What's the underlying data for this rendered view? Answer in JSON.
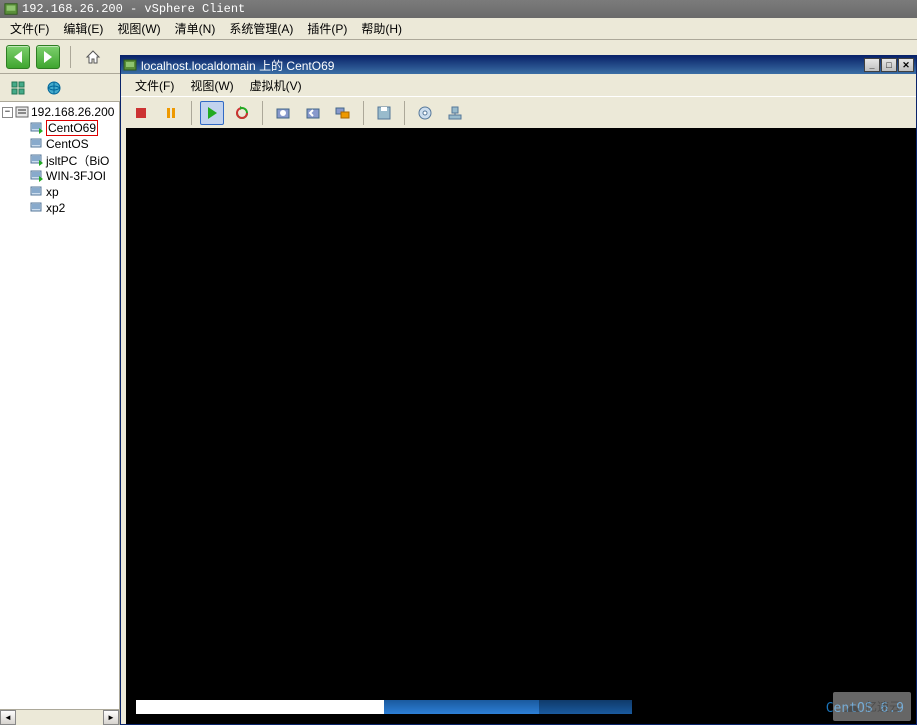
{
  "main_title": "192.168.26.200 - vSphere Client",
  "main_menu": {
    "file": "文件(F)",
    "edit": "编辑(E)",
    "view": "视图(W)",
    "inventory": "清单(N)",
    "admin": "系统管理(A)",
    "plugins": "插件(P)",
    "help": "帮助(H)"
  },
  "tree": {
    "host": "192.168.26.200",
    "vms": [
      {
        "name": "CentO69",
        "icon": "vm-on",
        "selected": true
      },
      {
        "name": "CentOS",
        "icon": "vm-off",
        "selected": false
      },
      {
        "name": "jsltPC（BiO",
        "icon": "vm-on",
        "selected": false
      },
      {
        "name": "WIN-3FJOI",
        "icon": "vm-on",
        "selected": false
      },
      {
        "name": "xp",
        "icon": "vm-off",
        "selected": false
      },
      {
        "name": "xp2",
        "icon": "vm-off",
        "selected": false
      }
    ]
  },
  "console": {
    "title": "localhost.localdomain 上的 CentO69",
    "menu": {
      "file": "文件(F)",
      "view": "视图(W)",
      "vm": "虚拟机(V)"
    },
    "os_label": "CentOS 6.9"
  },
  "watermark": "亿速云"
}
